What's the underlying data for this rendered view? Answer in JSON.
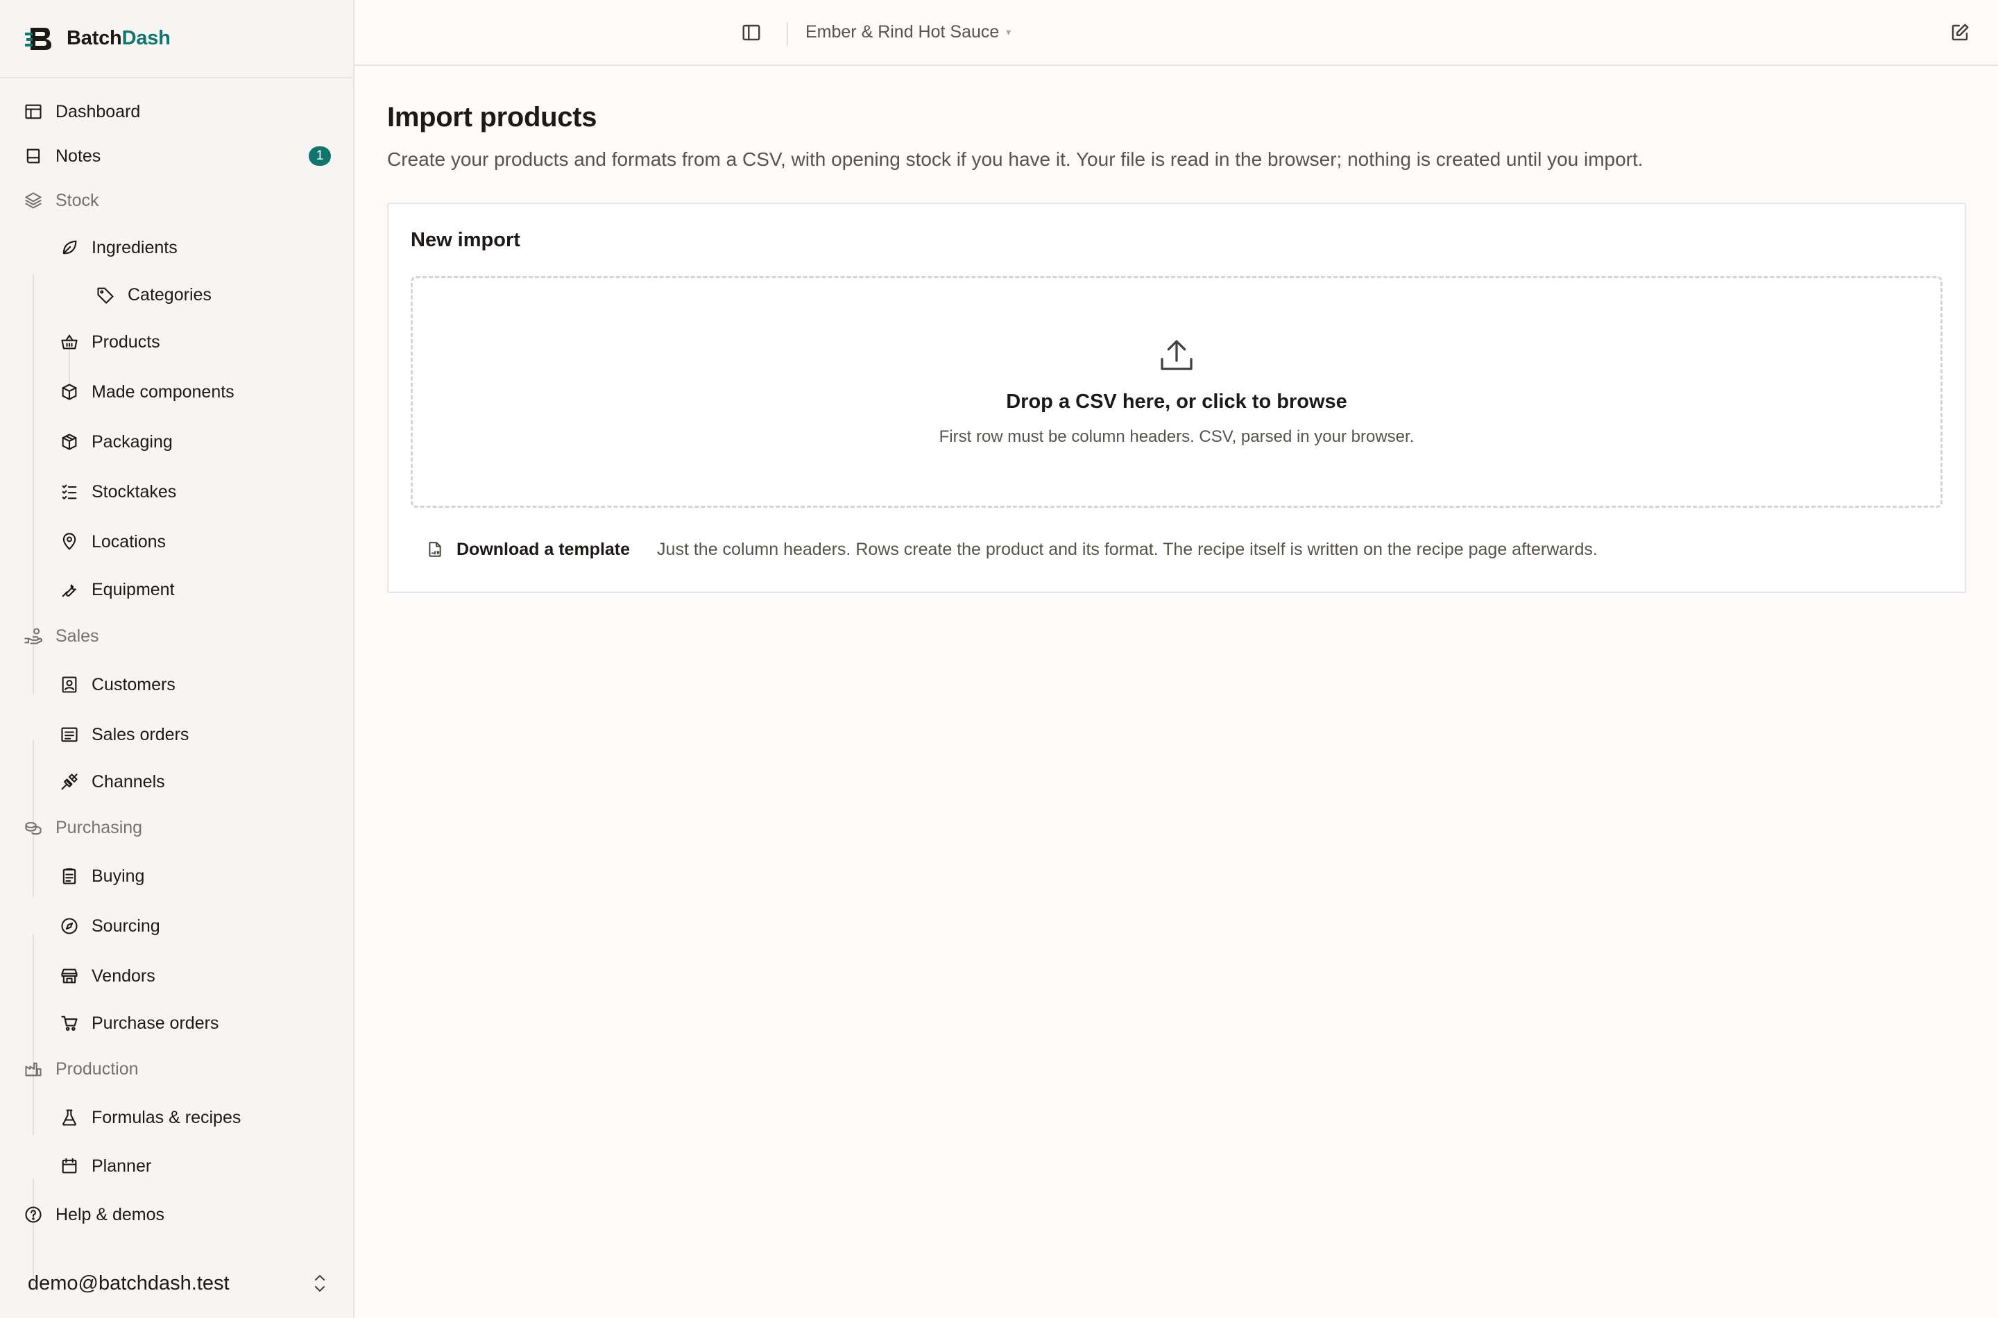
{
  "brand": {
    "name_part1": "Batch",
    "name_part2": "Dash"
  },
  "nav": {
    "dashboard": "Dashboard",
    "notes": "Notes",
    "notes_badge": "1",
    "stock": "Stock",
    "ingredients": "Ingredients",
    "categories": "Categories",
    "products": "Products",
    "made_components": "Made components",
    "packaging": "Packaging",
    "stocktakes": "Stocktakes",
    "locations": "Locations",
    "equipment": "Equipment",
    "sales": "Sales",
    "customers": "Customers",
    "sales_orders": "Sales orders",
    "channels": "Channels",
    "purchasing": "Purchasing",
    "buying": "Buying",
    "sourcing": "Sourcing",
    "vendors": "Vendors",
    "purchase_orders": "Purchase orders",
    "production": "Production",
    "formulas": "Formulas & recipes",
    "planner": "Planner",
    "help": "Help & demos"
  },
  "account": {
    "email": "demo@batchdash.test"
  },
  "topbar": {
    "workspace": "Ember & Rind Hot Sauce",
    "caret": "▾"
  },
  "page": {
    "title": "Import products",
    "subtitle": "Create your products and formats from a CSV, with opening stock if you have it. Your file is read in the browser; nothing is created until you import."
  },
  "card": {
    "title": "New import",
    "drop_title": "Drop a CSV here, or click to browse",
    "drop_sub": "First row must be column headers. CSV, parsed in your browser.",
    "template_label": "Download a template",
    "template_note": "Just the column headers. Rows create the product and its format. The recipe itself is written on the recipe page afterwards."
  },
  "colors": {
    "accent": "#0f766e",
    "muted": "#78716c",
    "text": "#1c1917"
  }
}
